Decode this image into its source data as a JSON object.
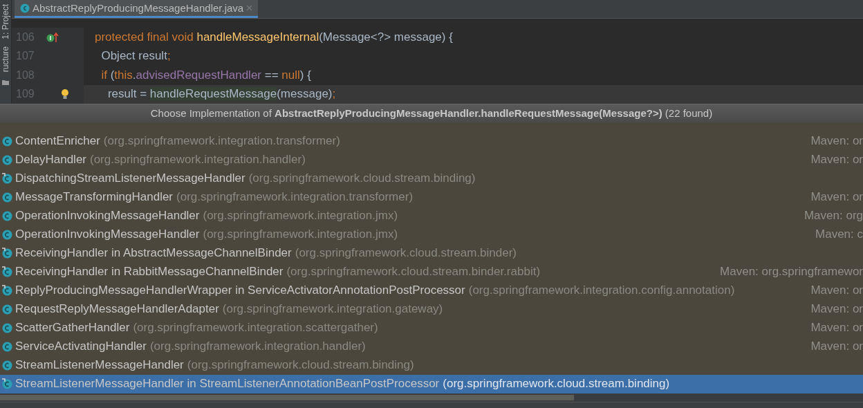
{
  "tool_strip": [
    {
      "label": "1: Project"
    },
    {
      "label": "ructure"
    }
  ],
  "tabs": [
    {
      "label": "AbstractReplyProducingMessageHandler.java",
      "selected": true
    }
  ],
  "code_lines": [
    {
      "number": "106",
      "gutter": {
        "kind": "implements"
      },
      "current": false,
      "tokens": [
        {
          "kind": "keyword",
          "text": "protected final void "
        },
        {
          "kind": "method",
          "text": "handleMessageInternal"
        },
        {
          "kind": "plain",
          "text": "(Message<?> message) {"
        }
      ]
    },
    {
      "number": "107",
      "current": false,
      "tokens": [
        {
          "kind": "plain",
          "text": "  Object result"
        },
        {
          "kind": "keyword",
          "text": ";"
        }
      ]
    },
    {
      "number": "108",
      "current": false,
      "tokens": [
        {
          "kind": "keyword",
          "text": "  if "
        },
        {
          "kind": "plain",
          "text": "("
        },
        {
          "kind": "keyword",
          "text": "this"
        },
        {
          "kind": "plain",
          "text": "."
        },
        {
          "kind": "field",
          "text": "advisedRequestHandler"
        },
        {
          "kind": "plain",
          "text": " == "
        },
        {
          "kind": "keyword",
          "text": "null"
        },
        {
          "kind": "plain",
          "text": ") {"
        }
      ]
    },
    {
      "number": "109",
      "gutter": {
        "kind": "bulb"
      },
      "current": true,
      "tokens": [
        {
          "kind": "plain",
          "text": "    result = "
        },
        {
          "kind": "usage",
          "text": "handleRequestMessage"
        },
        {
          "kind": "plain",
          "text": "(message)"
        },
        {
          "kind": "keyword",
          "text": ";"
        }
      ]
    }
  ],
  "popup": {
    "title": "Choose Implementation of **AbstractReplyProducingMessageHandler.handleRequestMessage(Message?>)** (22 found)",
    "items": [
      {
        "name": "ContentEnricher",
        "package": "(org.springframework.integration.transformer)",
        "location": "Maven: or",
        "inner": false,
        "selected": false
      },
      {
        "name": "DelayHandler",
        "package": "(org.springframework.integration.handler)",
        "location": "Maven: or",
        "inner": false,
        "selected": false
      },
      {
        "name": "DispatchingStreamListenerMessageHandler",
        "package": "(org.springframework.cloud.stream.binding)",
        "inner": true,
        "selected": false
      },
      {
        "name": "MessageTransformingHandler",
        "package": "(org.springframework.integration.transformer)",
        "location": "Maven: or",
        "inner": false,
        "selected": false
      },
      {
        "name": "OperationInvokingMessageHandler",
        "package": "(org.springframework.integration.jmx)",
        "location": "Maven: org",
        "inner": false,
        "selected": false
      },
      {
        "name": "OperationInvokingMessageHandler",
        "package": "(org.springframework.integration.jmx)",
        "location": "Maven: c",
        "inner": false,
        "selected": false
      },
      {
        "name": "ReceivingHandler in AbstractMessageChannelBinder",
        "package": "(org.springframework.cloud.stream.binder)",
        "inner": true,
        "selected": false
      },
      {
        "name": "ReceivingHandler in RabbitMessageChannelBinder",
        "package": "(org.springframework.cloud.stream.binder.rabbit)",
        "location": "Maven: org.springframewor",
        "inner": true,
        "selected": false
      },
      {
        "name": "ReplyProducingMessageHandlerWrapper in ServiceActivatorAnnotationPostProcessor",
        "package": "(org.springframework.integration.config.annotation)",
        "location": "Maven: or",
        "inner": true,
        "selected": false
      },
      {
        "name": "RequestReplyMessageHandlerAdapter",
        "package": "(org.springframework.integration.gateway)",
        "location": "Maven: or",
        "inner": false,
        "selected": false
      },
      {
        "name": "ScatterGatherHandler",
        "package": "(org.springframework.integration.scattergather)",
        "location": "Maven: or",
        "inner": false,
        "selected": false
      },
      {
        "name": "ServiceActivatingHandler",
        "package": "(org.springframework.integration.handler)",
        "location": "Maven: or",
        "inner": false,
        "selected": false
      },
      {
        "name": "StreamListenerMessageHandler",
        "package": "(org.springframework.cloud.stream.binding)",
        "inner": false,
        "selected": false
      },
      {
        "name": "StreamListenerMessageHandler in StreamListenerAnnotationBeanPostProcessor",
        "package": "(org.springframework.cloud.stream.binding)",
        "inner": true,
        "selected": true
      }
    ]
  }
}
